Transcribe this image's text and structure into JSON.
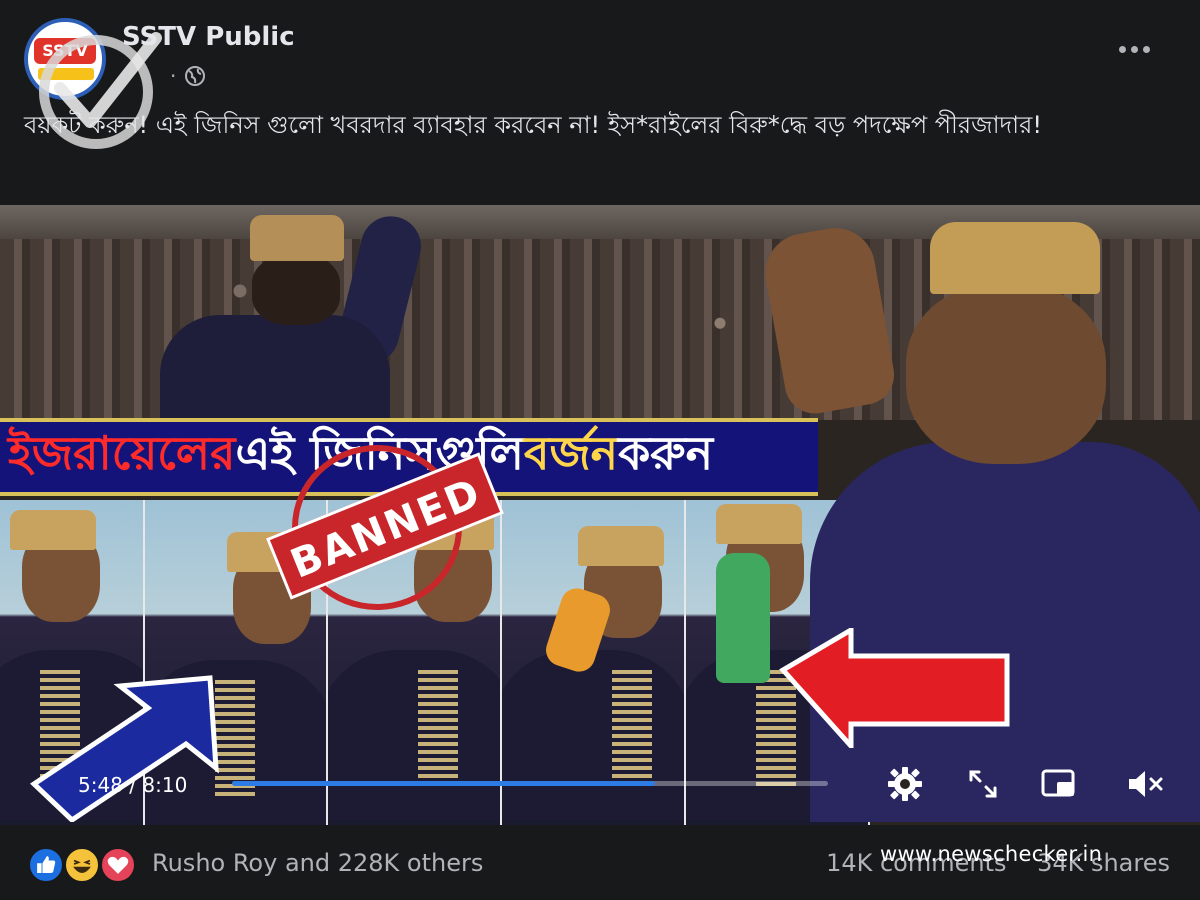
{
  "post": {
    "page_name": "SSTV Public",
    "avatar_logo_text": "SSTV",
    "time_separator": "·",
    "caption": "বয়কট করুন! এই জিনিস গুলো খবরদার ব্যাবহার করবেন না! ইস*রাইলের বিরু*দ্ধে বড় পদক্ষেপ পীরজাদার!"
  },
  "video": {
    "headline": {
      "part1": "ইজরায়েলের ",
      "part2": "এই জিনিসগুলি ",
      "part3": "বর্জন ",
      "part4": "করুন"
    },
    "stamp_text": "BANNED",
    "current_time": "5:48",
    "separator": "/",
    "duration": "8:10",
    "progress_fraction": 0.71,
    "controls": [
      "settings-icon",
      "fullscreen-icon",
      "picture-in-picture-icon",
      "mute-icon"
    ]
  },
  "footer": {
    "reactions": [
      "like",
      "haha",
      "love"
    ],
    "reaction_text": "Rusho Roy and 228K others",
    "comments_text": "14K comments",
    "shares_text": "34K shares"
  },
  "watermark": "www.newschecker.in",
  "colors": {
    "background": "#18191a",
    "text_primary": "#e4e6eb",
    "text_secondary": "#b0b3b8",
    "progress": "#2d7be5",
    "banner_bg": "#14137a",
    "stamp_red": "#c9262b"
  }
}
